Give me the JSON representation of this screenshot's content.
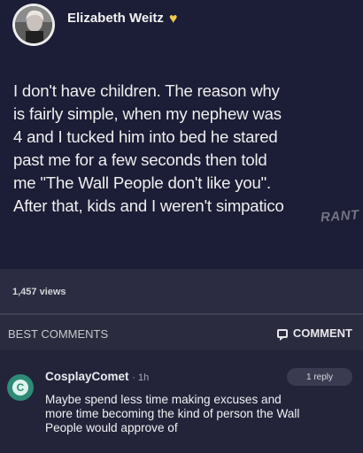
{
  "post": {
    "author": "Elizabeth Weitz",
    "author_badge_icon": "yellow-heart-icon",
    "text": "I don't have children. The reason why\nis fairly simple, when my nephew was\n4 and I tucked him into bed he stared\npast me for a few seconds then told\nme \"The Wall People don't like you\".\nAfter that, kids and I weren't simpatico",
    "watermark": "RANT",
    "views": "1,457 views"
  },
  "comments_header": {
    "sort_label": "BEST COMMENTS",
    "comment_button": "COMMENT"
  },
  "comment": {
    "avatar_letter": "C",
    "username": "CosplayComet",
    "time": "· 1h",
    "reply_count": "1 reply",
    "text": "Maybe spend less time making excuses and\nmore time becoming the kind of person the Wall\nPeople would approve of"
  },
  "colors": {
    "heart": "#f2c94c",
    "avatar": "#2e8b78"
  }
}
